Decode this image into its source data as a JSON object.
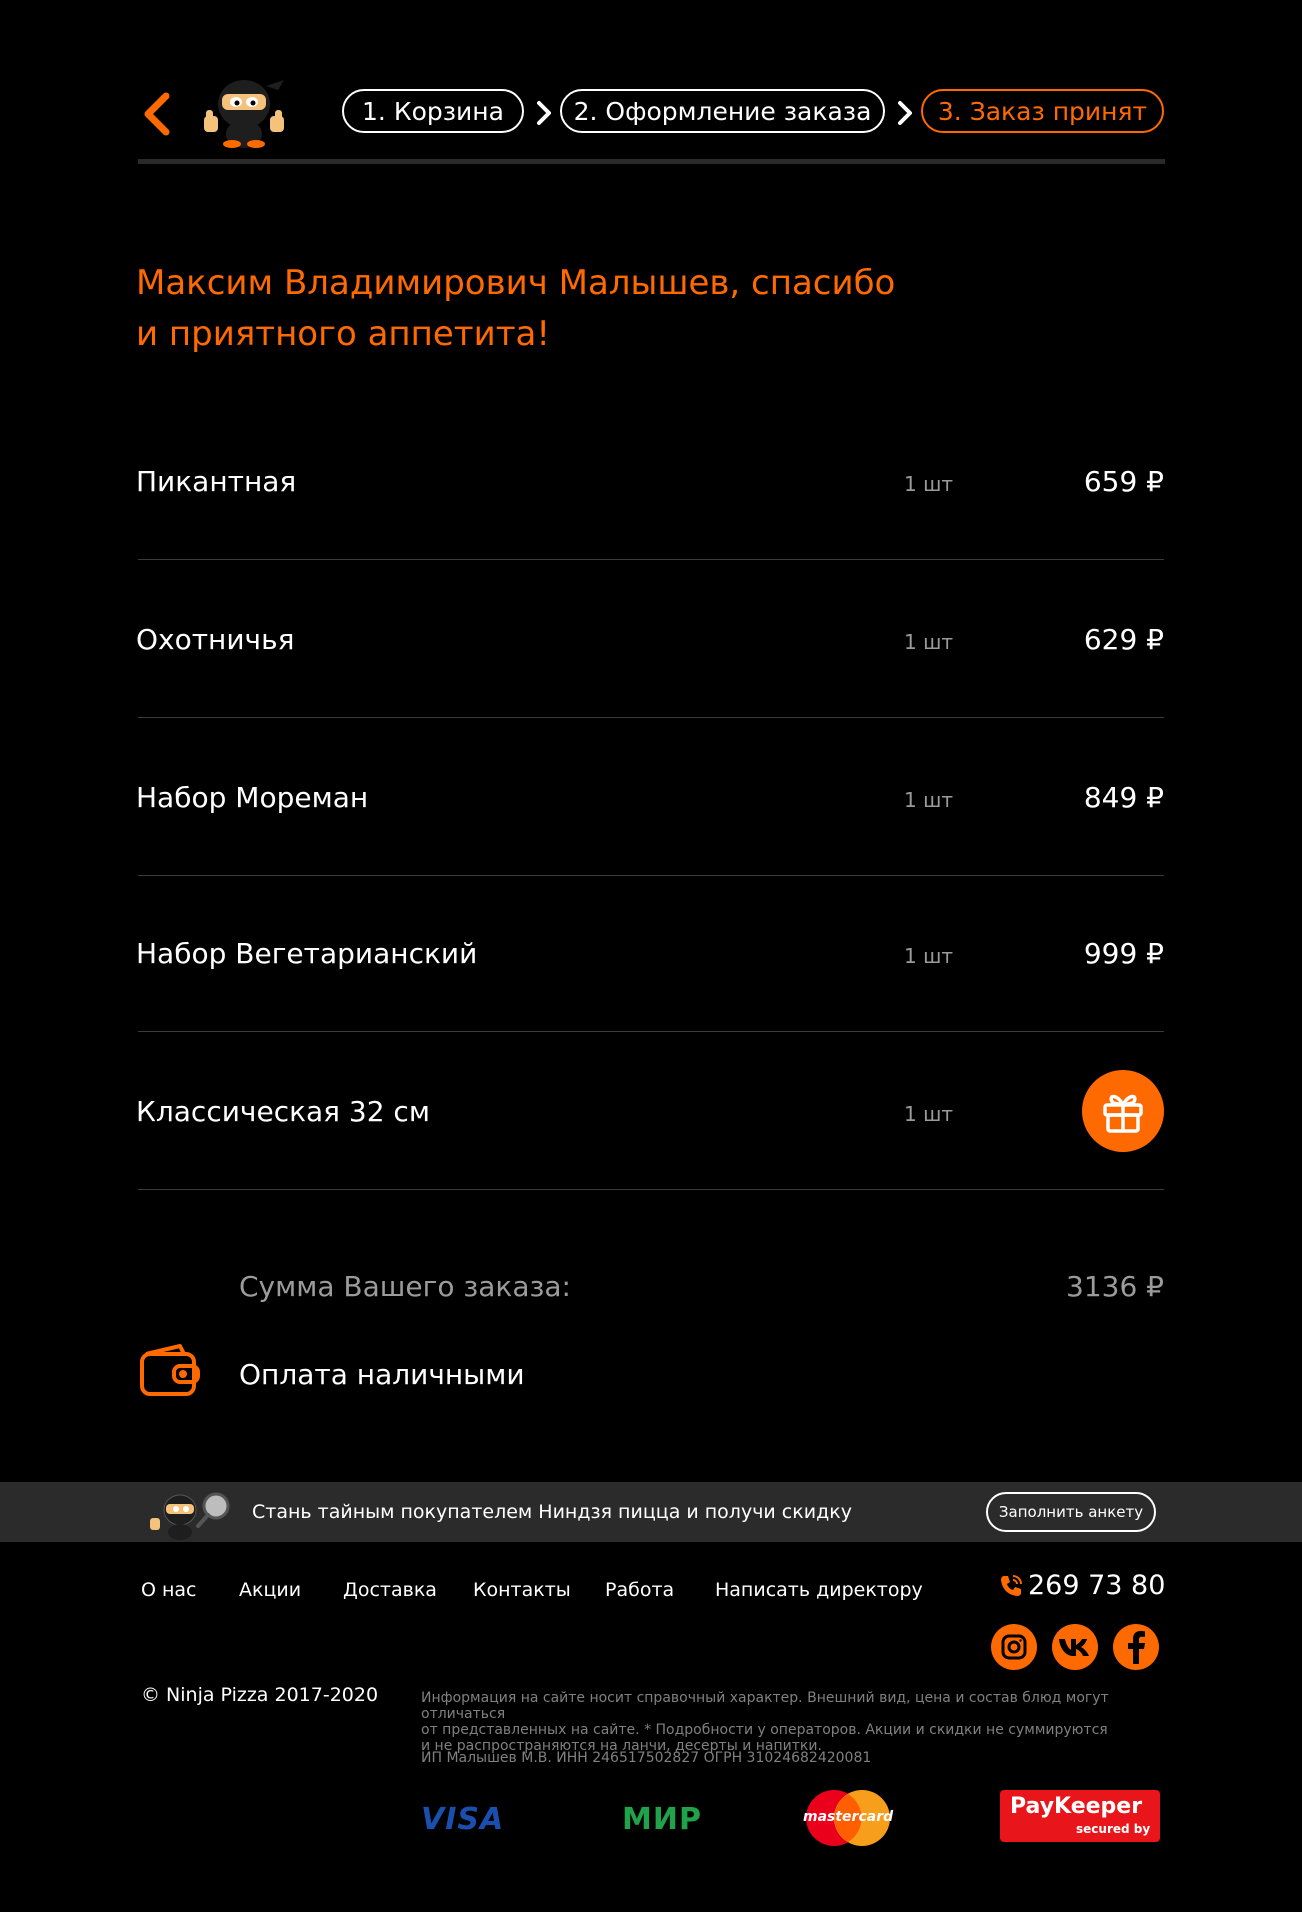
{
  "header": {
    "steps": [
      {
        "label": "1. Корзина",
        "active": false
      },
      {
        "label": "2. Оформление заказа",
        "active": false
      },
      {
        "label": "3. Заказ принят",
        "active": true
      }
    ]
  },
  "thanks": {
    "line1": "Максим Владимирович Малышев, спасибо",
    "line2": "и приятного аппетита!"
  },
  "items": [
    {
      "name": "Пикантная",
      "qty": "1 шт",
      "price": "659 ₽"
    },
    {
      "name": "Охотничья",
      "qty": "1 шт",
      "price": "629 ₽"
    },
    {
      "name": "Набор Мореман",
      "qty": "1 шт",
      "price": "849 ₽"
    },
    {
      "name": "Набор Вегетарианский",
      "qty": "1 шт",
      "price": "999 ₽"
    },
    {
      "name": "Классическая 32 см",
      "qty": "1 шт",
      "price": "",
      "icon": "gift-icon"
    }
  ],
  "summary": {
    "label": "Сумма Вашего заказа:",
    "value": "3136 ₽",
    "payment_method": "Оплата наличными",
    "payment_icon": "wallet-icon"
  },
  "promo": {
    "text": "Стань тайным покупателем Ниндзя пицца и получи скидку",
    "button": "Заполнить анкету"
  },
  "footer": {
    "nav": [
      "О нас",
      "Акции",
      "Доставка",
      "Контакты",
      "Работа",
      "Написать директору"
    ],
    "phone": "269 73 80",
    "social": [
      "instagram-icon",
      "vk-icon",
      "facebook-icon"
    ],
    "copyright": "© Ninja Pizza 2017-2020",
    "legal_line1": "Информация на сайте носит справочный характер. Внешний вид, цена и состав блюд могут отличаться",
    "legal_line2": "от представленных на сайте. * Подробности у операторов. Акции и скидки не суммируются",
    "legal_line3": "и не распространяются на ланчи, десерты и напитки.",
    "requisites": "ИП Малышев М.В. ИНН 246517502827 ОГРН 31024682420081",
    "payments": {
      "visa": "VISA",
      "mir": "МИР",
      "mastercard": "mastercard",
      "paykeeper": "PayKeeper",
      "paykeeper_sub": "secured by"
    }
  },
  "colors": {
    "accent": "#ff6a00",
    "muted": "#9b9b9b",
    "divider": "#3a3a3a"
  }
}
